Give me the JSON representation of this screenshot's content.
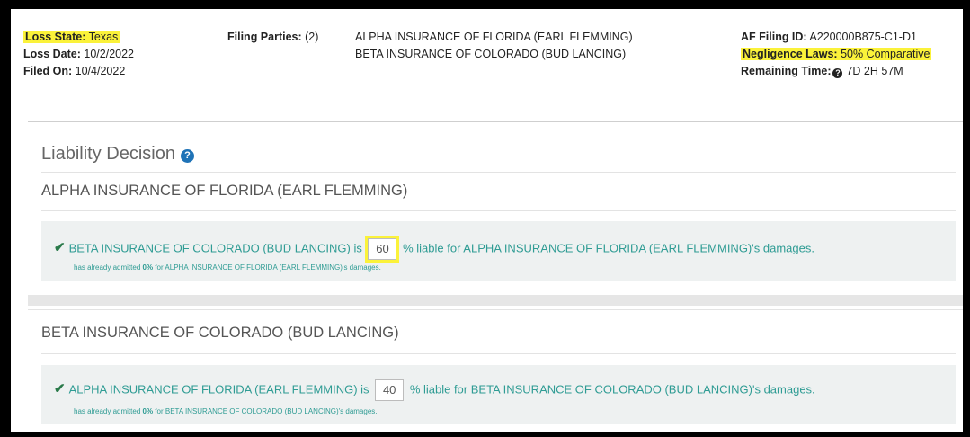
{
  "header": {
    "loss_state_label": "Loss State:",
    "loss_state_value": "Texas",
    "loss_date_label": "Loss Date:",
    "loss_date_value": "10/2/2022",
    "filed_on_label": "Filed On:",
    "filed_on_value": "10/4/2022",
    "filing_parties_label": "Filing Parties:",
    "filing_parties_count": "(2)",
    "filing_parties": [
      "ALPHA INSURANCE OF FLORIDA (EARL FLEMMING)",
      "BETA INSURANCE OF COLORADO (BUD LANCING)"
    ],
    "af_filing_id_label": "AF Filing ID:",
    "af_filing_id_value": "A220000B875-C1-D1",
    "negligence_label": "Negligence Laws:",
    "negligence_value": "50% Comparative",
    "remaining_label": "Remaining Time:",
    "remaining_value": "7D 2H 57M"
  },
  "liability": {
    "title": "Liability Decision",
    "decisions": [
      {
        "party_heading": "ALPHA INSURANCE OF FLORIDA (EARL FLEMMING)",
        "liable_party": "BETA INSURANCE OF COLORADO (BUD LANCING)",
        "is_text": "is",
        "percent": "60",
        "liable_for_text": "% liable for ALPHA INSURANCE OF FLORIDA (EARL FLEMMING)'s damages.",
        "admitted_prefix": "has already admitted",
        "admitted_pct": "0%",
        "admitted_suffix": "for ALPHA INSURANCE OF FLORIDA (EARL FLEMMING)'s damages.",
        "highlighted": true
      },
      {
        "party_heading": "BETA INSURANCE OF COLORADO (BUD LANCING)",
        "liable_party": "ALPHA INSURANCE OF FLORIDA (EARL FLEMMING)",
        "is_text": "is",
        "percent": "40",
        "liable_for_text": "% liable for BETA INSURANCE OF COLORADO (BUD LANCING)'s damages.",
        "admitted_prefix": "has already admitted",
        "admitted_pct": "0%",
        "admitted_suffix": "for BETA INSURANCE OF COLORADO (BUD LANCING)'s damages.",
        "highlighted": false
      }
    ]
  },
  "colors": {
    "highlight": "#fbf23a",
    "accent_teal": "#2f9c94",
    "info_blue": "#1f73b7"
  }
}
